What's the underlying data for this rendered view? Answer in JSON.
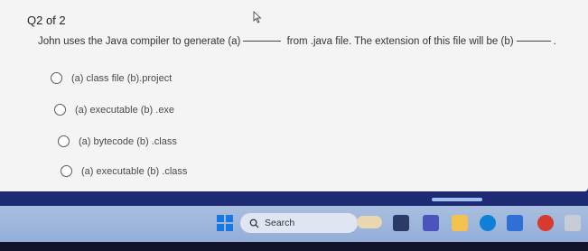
{
  "quiz": {
    "counter": "Q2 of 2",
    "question": {
      "part1": "John uses the Java compiler to generate (a)",
      "part2": "from .java file. The extension of this file will be (b)",
      "part3": "."
    },
    "options": [
      {
        "label": "(a) class file (b).project"
      },
      {
        "label": "(a) executable (b) .exe"
      },
      {
        "label": "(a) bytecode (b) .class"
      },
      {
        "label": "(a) executable (b) .class"
      }
    ]
  },
  "taskbar": {
    "search_label": "Search",
    "icons": [
      "start-icon",
      "search-icon",
      "widgets-icon",
      "task-view-icon",
      "teams-icon",
      "file-explorer-icon",
      "edge-icon",
      "store-icon",
      "chrome-icon",
      "app-icon"
    ],
    "accent": "#1877e0"
  }
}
